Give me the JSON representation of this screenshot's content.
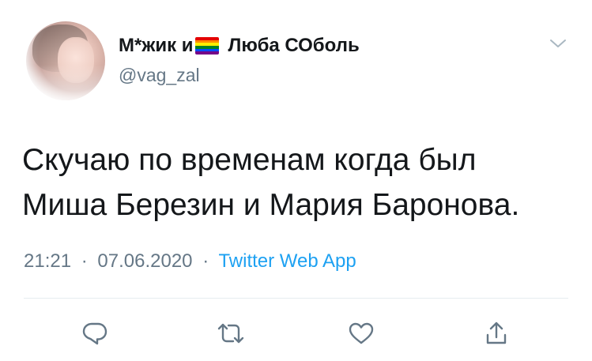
{
  "tweet": {
    "display_name": "М*жик и",
    "display_name_suffix": "Люба СОболь",
    "flag_icon": "rainbow-flag-icon",
    "flag_colors": [
      "#e40303",
      "#ff8c00",
      "#ffed00",
      "#008026",
      "#004dff",
      "#750787"
    ],
    "handle": "@vag_zal",
    "text_line1": "Скучаю по временам когда был",
    "text_line2": "Миша Березин и Мария Баронова.",
    "time": "21:21",
    "separator": "·",
    "date": "07.06.2020",
    "source": "Twitter Web App"
  },
  "actions": {
    "reply_icon": "reply-icon",
    "retweet_icon": "retweet-icon",
    "like_icon": "heart-icon",
    "share_icon": "share-icon",
    "icon_color": "#657786"
  },
  "colors": {
    "link": "#1da1f2",
    "secondary_text": "#657786",
    "primary_text": "#14171a",
    "divider": "#e6ecf0"
  }
}
